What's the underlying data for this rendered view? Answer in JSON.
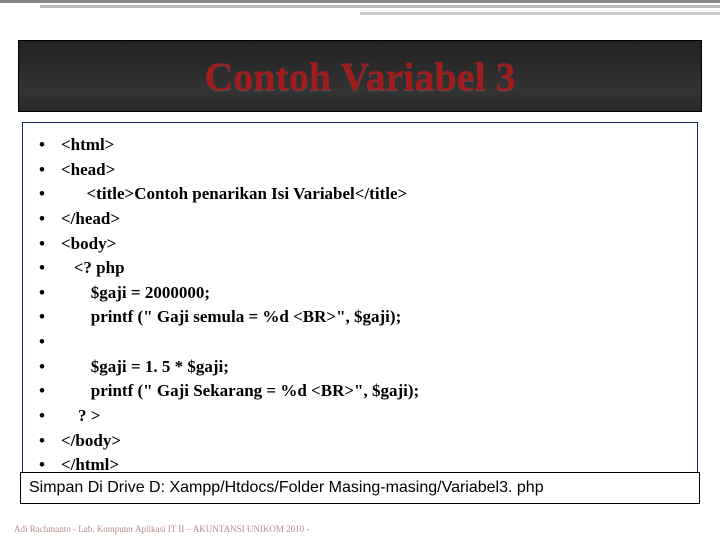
{
  "title": "Contoh Variabel 3",
  "code_lines": [
    "<html>",
    "<head>",
    "      <title>Contoh penarikan Isi Variabel</title>",
    "</head>",
    "<body>",
    "   <? php",
    "       $gaji = 2000000;",
    "       printf (\" Gaji semula = %d <BR>\", $gaji);",
    "",
    "       $gaji = 1. 5 * $gaji;",
    "       printf (\" Gaji Sekarang = %d <BR>\", $gaji);",
    "    ? >",
    "</body>",
    "</html>"
  ],
  "note": "Simpan Di Drive D: Xampp/Htdocs/Folder Masing-masing/Variabel3. php",
  "footer": "Adi Rachmanto - Lab. Komputer Aplikasi IT II – AKUNTANSI UNIKOM 2010 -"
}
